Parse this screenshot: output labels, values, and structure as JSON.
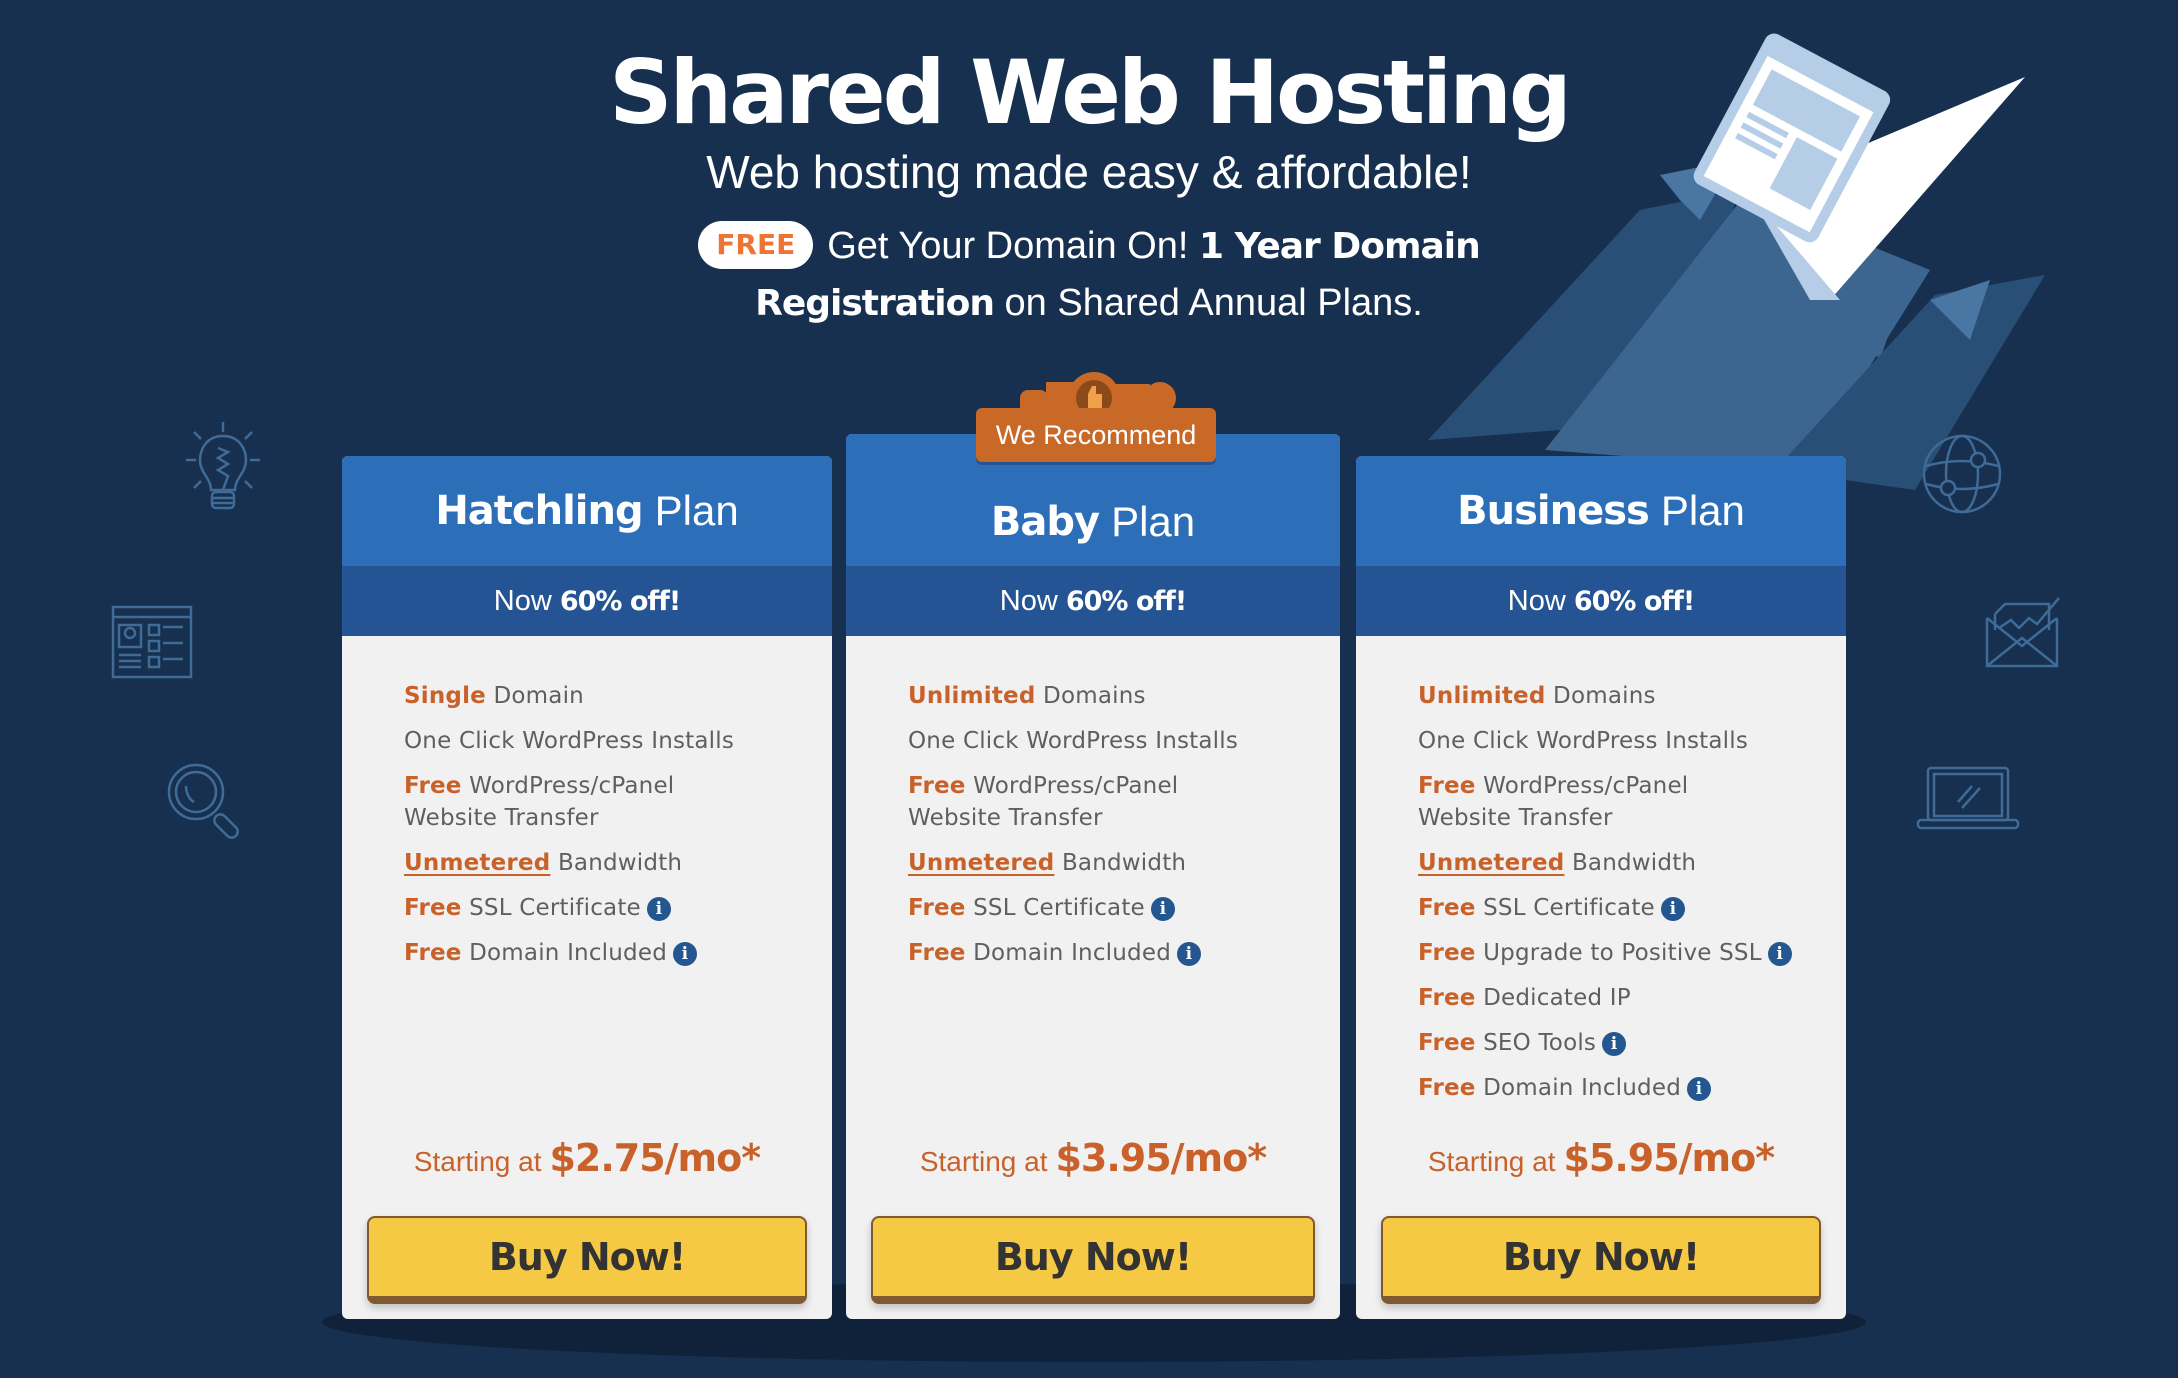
{
  "hero": {
    "title": "Shared Web Hosting",
    "subtitle": "Web hosting made easy & affordable!",
    "promo": {
      "badge": "FREE",
      "text_before": "Get Your Domain On!",
      "bold_1": "1 Year Domain",
      "bold_2": "Registration",
      "text_after": "on Shared Annual Plans."
    }
  },
  "recommend_label": "We Recommend",
  "plans": [
    {
      "name_bold": "Hatchling",
      "name_rest": "Plan",
      "discount_prefix": "Now",
      "discount": "60% off!",
      "features": [
        {
          "hl": "Single",
          "text": "Domain",
          "underline": false,
          "info": false
        },
        {
          "hl": "",
          "text": "One Click WordPress Installs",
          "underline": false,
          "info": false
        },
        {
          "hl": "Free",
          "text": "WordPress/cPanel Website Transfer",
          "underline": false,
          "info": false
        },
        {
          "hl": "Unmetered",
          "text": "Bandwidth",
          "underline": true,
          "info": false
        },
        {
          "hl": "Free",
          "text": "SSL Certificate",
          "underline": false,
          "info": true
        },
        {
          "hl": "Free",
          "text": "Domain Included",
          "underline": false,
          "info": true
        }
      ],
      "price_prefix": "Starting at",
      "price": "$2.75/mo*",
      "button": "Buy Now!"
    },
    {
      "name_bold": "Baby",
      "name_rest": "Plan",
      "discount_prefix": "Now",
      "discount": "60% off!",
      "features": [
        {
          "hl": "Unlimited",
          "text": "Domains",
          "underline": false,
          "info": false
        },
        {
          "hl": "",
          "text": "One Click WordPress Installs",
          "underline": false,
          "info": false
        },
        {
          "hl": "Free",
          "text": "WordPress/cPanel Website Transfer",
          "underline": false,
          "info": false
        },
        {
          "hl": "Unmetered",
          "text": "Bandwidth",
          "underline": true,
          "info": false
        },
        {
          "hl": "Free",
          "text": "SSL Certificate",
          "underline": false,
          "info": true
        },
        {
          "hl": "Free",
          "text": "Domain Included",
          "underline": false,
          "info": true
        }
      ],
      "price_prefix": "Starting at",
      "price": "$3.95/mo*",
      "button": "Buy Now!"
    },
    {
      "name_bold": "Business",
      "name_rest": "Plan",
      "discount_prefix": "Now",
      "discount": "60% off!",
      "features": [
        {
          "hl": "Unlimited",
          "text": "Domains",
          "underline": false,
          "info": false
        },
        {
          "hl": "",
          "text": "One Click WordPress Installs",
          "underline": false,
          "info": false
        },
        {
          "hl": "Free",
          "text": "WordPress/cPanel Website Transfer",
          "underline": false,
          "info": false
        },
        {
          "hl": "Unmetered",
          "text": "Bandwidth",
          "underline": true,
          "info": false
        },
        {
          "hl": "Free",
          "text": "SSL Certificate",
          "underline": false,
          "info": true
        },
        {
          "hl": "Free",
          "text": "Upgrade to Positive SSL",
          "underline": false,
          "info": true
        },
        {
          "hl": "Free",
          "text": "Dedicated IP",
          "underline": false,
          "info": false
        },
        {
          "hl": "Free",
          "text": "SEO Tools",
          "underline": false,
          "info": true
        },
        {
          "hl": "Free",
          "text": "Domain Included",
          "underline": false,
          "info": true
        }
      ],
      "price_prefix": "Starting at",
      "price": "$5.95/mo*",
      "button": "Buy Now!"
    }
  ],
  "info_glyph": "i",
  "colors": {
    "background": "#17304f",
    "card_header": "#2c6eb8",
    "card_subheader": "#245493",
    "card_body": "#f1f1f1",
    "accent_orange": "#c8622a",
    "free_badge_text": "#ee7433",
    "button": "#f6c945",
    "button_border": "#7f5a30",
    "info_icon": "#24568f"
  },
  "decorations": [
    "lightbulb-icon",
    "web-profile-icon",
    "magnifier-icon",
    "globe-icon",
    "envelope-chart-icon",
    "laptop-icon",
    "rocket-illustration"
  ]
}
